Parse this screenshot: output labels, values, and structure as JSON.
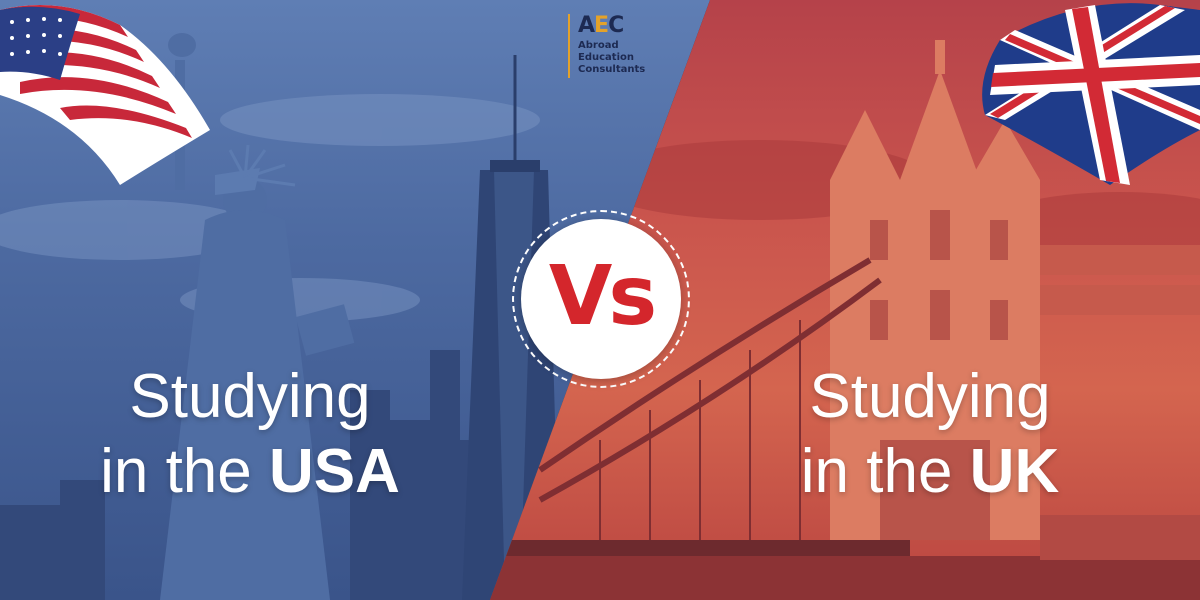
{
  "logo": {
    "mark_a": "A",
    "mark_e": "E",
    "mark_c": "C",
    "lines": [
      "Abroad",
      "Education",
      "Consultants"
    ]
  },
  "vs_label": "Vs",
  "left": {
    "line1": "Studying",
    "line2_prefix": "in the",
    "line2_country": "USA"
  },
  "right": {
    "line1": "Studying",
    "line2_prefix": "in the",
    "line2_country": "UK"
  },
  "colors": {
    "usa_tint": "#4d6aa1",
    "uk_tint": "#c9544d",
    "vs_red": "#d4262c",
    "logo_navy": "#1d2a52",
    "logo_gold": "#e4a22a"
  },
  "icons": {
    "usa_flag": "us-flag-icon",
    "uk_flag": "uk-flag-icon"
  }
}
